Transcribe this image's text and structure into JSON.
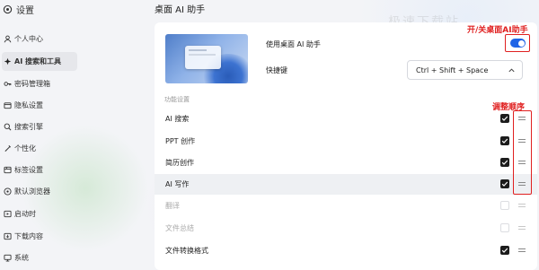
{
  "sidebar": {
    "title": "设置",
    "items": [
      {
        "label": "个人中心",
        "icon": "person-icon"
      },
      {
        "label": "AI 搜索和工具",
        "icon": "ai-icon"
      },
      {
        "label": "密码管理箱",
        "icon": "key-icon"
      },
      {
        "label": "隐私设置",
        "icon": "privacy-icon"
      },
      {
        "label": "搜索引擎",
        "icon": "search-icon"
      },
      {
        "label": "个性化",
        "icon": "palette-icon"
      },
      {
        "label": "标签设置",
        "icon": "tab-icon"
      },
      {
        "label": "默认浏览器",
        "icon": "browser-icon"
      },
      {
        "label": "启动时",
        "icon": "startup-icon"
      },
      {
        "label": "下载内容",
        "icon": "download-icon"
      },
      {
        "label": "系统",
        "icon": "system-icon"
      }
    ]
  },
  "main": {
    "title": "桌面 AI 助手",
    "enable_label": "使用桌面 AI 助手",
    "enable_on": true,
    "shortcut_label": "快捷键",
    "shortcut_value": "Ctrl + Shift + Space",
    "section_label": "功能设置",
    "features": [
      {
        "name": "AI 搜索",
        "checked": true,
        "enabled": true
      },
      {
        "name": "PPT 创作",
        "checked": true,
        "enabled": true
      },
      {
        "name": "简历创作",
        "checked": true,
        "enabled": true
      },
      {
        "name": "AI 写作",
        "checked": true,
        "enabled": true
      },
      {
        "name": "翻译",
        "checked": false,
        "enabled": false
      },
      {
        "name": "文件总结",
        "checked": false,
        "enabled": false
      },
      {
        "name": "文件转换格式",
        "checked": true,
        "enabled": true
      }
    ]
  },
  "annotations": {
    "toggle_note": "开/关桌面AI助手",
    "order_note": "调整顺序",
    "color": "#e02020"
  },
  "watermark": "极速下载站",
  "colors": {
    "accent": "#1f64e6",
    "checkbox": "#1c1c1c",
    "annotation": "#e02020"
  }
}
